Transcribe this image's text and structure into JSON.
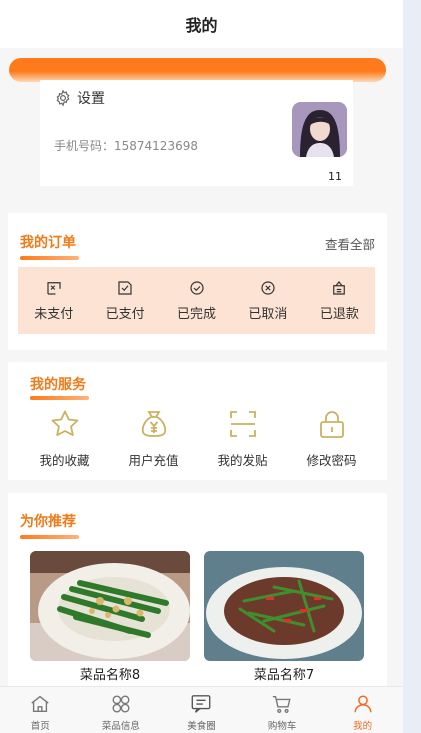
{
  "header": {
    "title": "我的"
  },
  "profile": {
    "settings_label": "设置",
    "phone": "手机号码：15874123698",
    "avatar_caption": "11"
  },
  "orders": {
    "title": "我的订单",
    "view_all": "查看全部",
    "items": [
      {
        "label": "未支付",
        "icon": "unpaid-icon"
      },
      {
        "label": "已支付",
        "icon": "paid-icon"
      },
      {
        "label": "已完成",
        "icon": "completed-icon"
      },
      {
        "label": "已取消",
        "icon": "cancelled-icon"
      },
      {
        "label": "已退款",
        "icon": "refunded-icon"
      }
    ]
  },
  "services": {
    "title": "我的服务",
    "items": [
      {
        "label": "我的收藏",
        "icon": "star-icon"
      },
      {
        "label": "用户充值",
        "icon": "money-bag-icon"
      },
      {
        "label": "我的发贴",
        "icon": "scan-icon"
      },
      {
        "label": "修改密码",
        "icon": "lock-icon"
      }
    ]
  },
  "recommend": {
    "title": "为你推荐",
    "dishes": [
      {
        "name": "菜品名称8"
      },
      {
        "name": "菜品名称7"
      }
    ]
  },
  "tabbar": {
    "items": [
      {
        "label": "首页",
        "icon": "home-icon",
        "active": false
      },
      {
        "label": "菜品信息",
        "icon": "grid-icon",
        "active": false
      },
      {
        "label": "美食圈",
        "icon": "chat-icon",
        "active": false
      },
      {
        "label": "购物车",
        "icon": "cart-icon",
        "active": false
      },
      {
        "label": "我的",
        "icon": "user-icon",
        "active": true
      }
    ]
  },
  "colors": {
    "accent": "#ff7a1a",
    "active_tab": "#ef6a23",
    "order_strip_bg": "#fde3d4",
    "service_icon": "#c9b25f"
  }
}
